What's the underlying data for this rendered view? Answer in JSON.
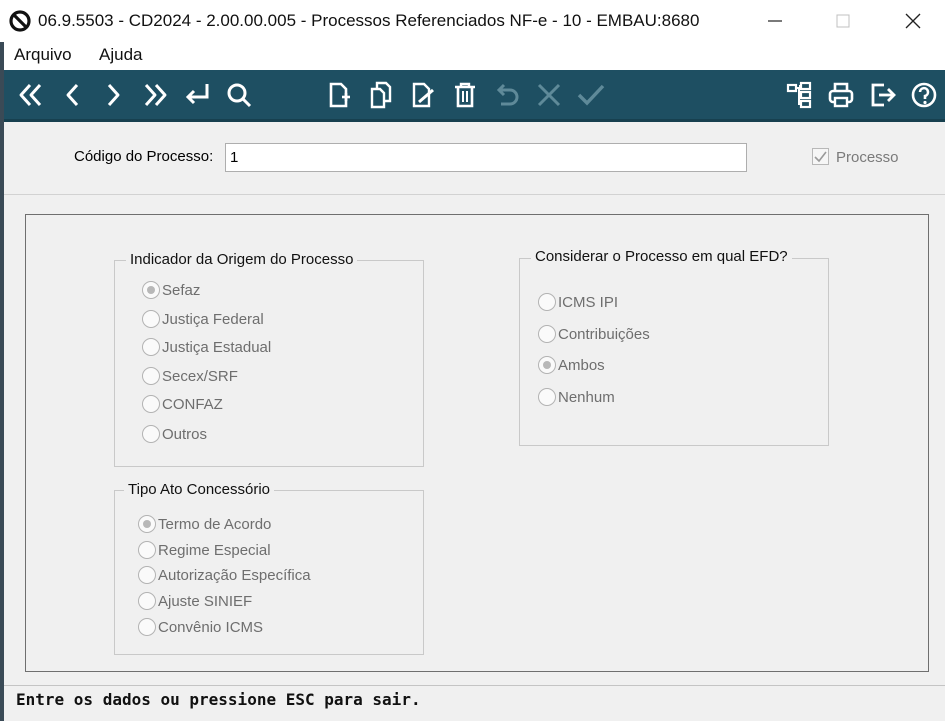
{
  "window": {
    "title": "06.9.5503 - CD2024 - 2.00.00.005 - Processos Referenciados NF-e - 10 - EMBAU:8680"
  },
  "menu": {
    "items": [
      "Arquivo",
      "Ajuda"
    ]
  },
  "toolbar": {
    "icons": [
      "first-record-icon",
      "previous-record-icon",
      "next-record-icon",
      "last-record-icon",
      "enter-icon",
      "search-icon",
      "new-document-icon",
      "copy-document-icon",
      "edit-document-icon",
      "delete-icon",
      "undo-icon",
      "cancel-icon",
      "confirm-icon",
      "tree-structure-icon",
      "print-icon",
      "exit-icon",
      "help-icon"
    ],
    "color": "#1e4f62"
  },
  "header": {
    "codigo_label": "Código do Processo:",
    "codigo_value": "1",
    "processo_label": "Processo",
    "processo_checked": true
  },
  "origem": {
    "title": "Indicador da Origem do Processo",
    "options": [
      "Sefaz",
      "Justiça Federal",
      "Justiça Estadual",
      "Secex/SRF",
      "CONFAZ",
      "Outros"
    ],
    "selected": "Sefaz"
  },
  "efd": {
    "title": "Considerar o Processo em qual EFD?",
    "options": [
      "ICMS IPI",
      "Contribuições",
      "Ambos",
      "Nenhum"
    ],
    "selected": "Ambos"
  },
  "tipo_ato": {
    "title": "Tipo Ato Concessório",
    "options": [
      "Termo de Acordo",
      "Regime Especial",
      "Autorização Específica",
      "Ajuste SINIEF",
      "Convênio ICMS"
    ],
    "selected": "Termo de Acordo"
  },
  "status": {
    "text": "Entre os dados ou pressione ESC para sair."
  }
}
